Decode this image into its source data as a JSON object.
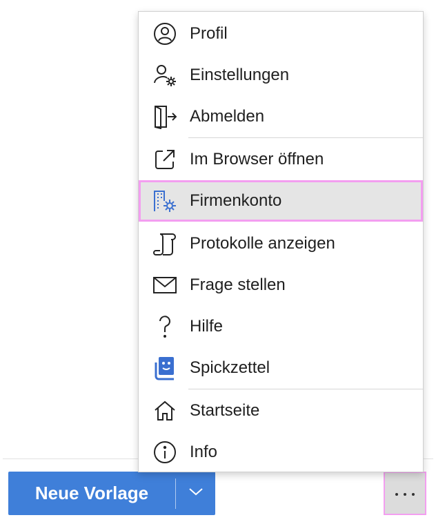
{
  "menu": {
    "items": [
      {
        "label": "Profil",
        "icon": "profile-icon"
      },
      {
        "label": "Einstellungen",
        "icon": "user-settings-icon"
      },
      {
        "label": "Abmelden",
        "icon": "sign-out-icon"
      },
      {
        "label": "Im Browser öffnen",
        "icon": "open-external-icon"
      },
      {
        "label": "Firmenkonto",
        "icon": "company-settings-icon"
      },
      {
        "label": "Protokolle anzeigen",
        "icon": "log-scroll-icon"
      },
      {
        "label": "Frage stellen",
        "icon": "mail-icon"
      },
      {
        "label": "Hilfe",
        "icon": "question-icon"
      },
      {
        "label": "Spickzettel",
        "icon": "cheat-sheet-icon"
      },
      {
        "label": "Startseite",
        "icon": "home-icon"
      },
      {
        "label": "Info",
        "icon": "info-icon"
      }
    ],
    "highlighted_item": "Firmenkonto"
  },
  "footer": {
    "new_template_label": "Neue Vorlage",
    "dropdown_icon": "chevron-down-icon",
    "more_icon": "ellipsis-icon"
  },
  "colors": {
    "accent": "#3f7fd9",
    "highlight_border": "#f39ef0",
    "highlight_bg": "#e5e5e5",
    "icon_blue": "#3a6fd0"
  }
}
